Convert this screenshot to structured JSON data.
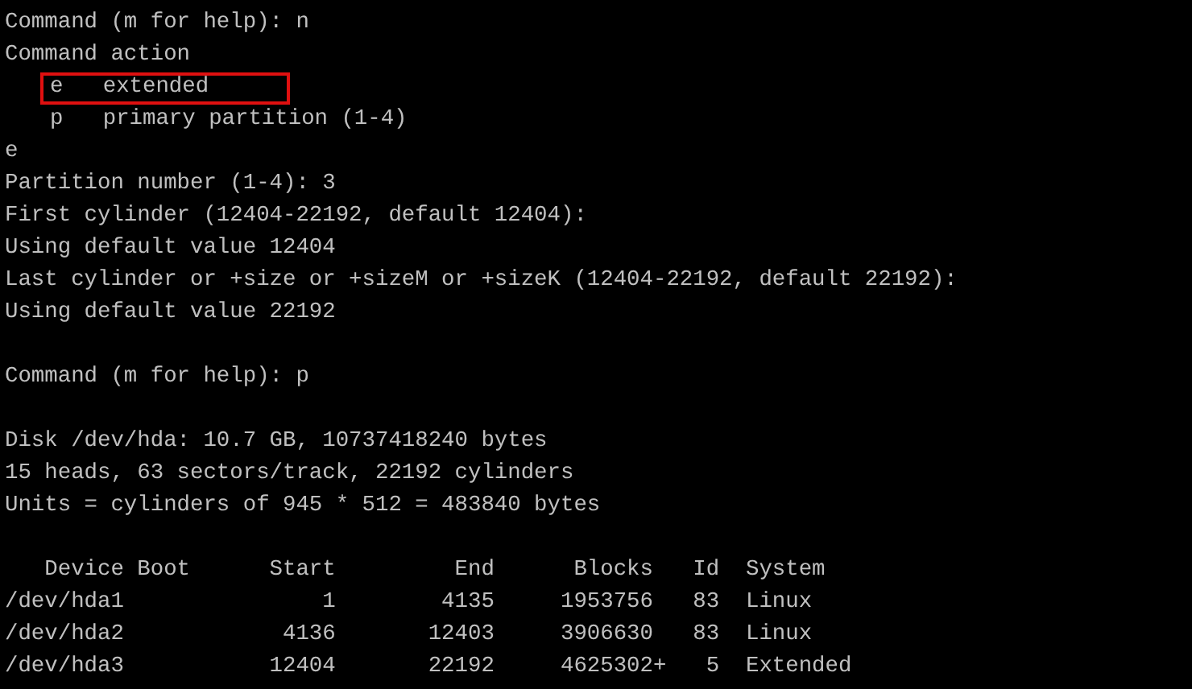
{
  "terminal": {
    "lines": [
      {
        "kind": "text",
        "text": "Command (m for help): n"
      },
      {
        "kind": "text",
        "text": "Command action"
      },
      {
        "kind": "option",
        "key": "e",
        "label": "extended",
        "boxed": true
      },
      {
        "kind": "option",
        "key": "p",
        "label": "primary partition (1-4)",
        "boxed": false
      },
      {
        "kind": "text",
        "text": "e"
      },
      {
        "kind": "text",
        "text": "Partition number (1-4): 3"
      },
      {
        "kind": "text",
        "text": "First cylinder (12404-22192, default 12404):"
      },
      {
        "kind": "text",
        "text": "Using default value 12404"
      },
      {
        "kind": "text",
        "text": "Last cylinder or +size or +sizeM or +sizeK (12404-22192, default 22192):"
      },
      {
        "kind": "text",
        "text": "Using default value 22192"
      },
      {
        "kind": "blank"
      },
      {
        "kind": "text",
        "text": "Command (m for help): p"
      },
      {
        "kind": "blank"
      },
      {
        "kind": "text",
        "text": "Disk /dev/hda: 10.7 GB, 10737418240 bytes"
      },
      {
        "kind": "text",
        "text": "15 heads, 63 sectors/track, 22192 cylinders"
      },
      {
        "kind": "text",
        "text": "Units = cylinders of 945 * 512 = 483840 bytes"
      },
      {
        "kind": "blank"
      },
      {
        "kind": "text",
        "text": "   Device Boot      Start         End      Blocks   Id  System"
      },
      {
        "kind": "text",
        "text": "/dev/hda1               1        4135     1953756   83  Linux"
      },
      {
        "kind": "text",
        "text": "/dev/hda2            4136       12403     3906630   83  Linux"
      },
      {
        "kind": "text",
        "text": "/dev/hda3           12404       22192     4625302+   5  Extended"
      }
    ]
  }
}
